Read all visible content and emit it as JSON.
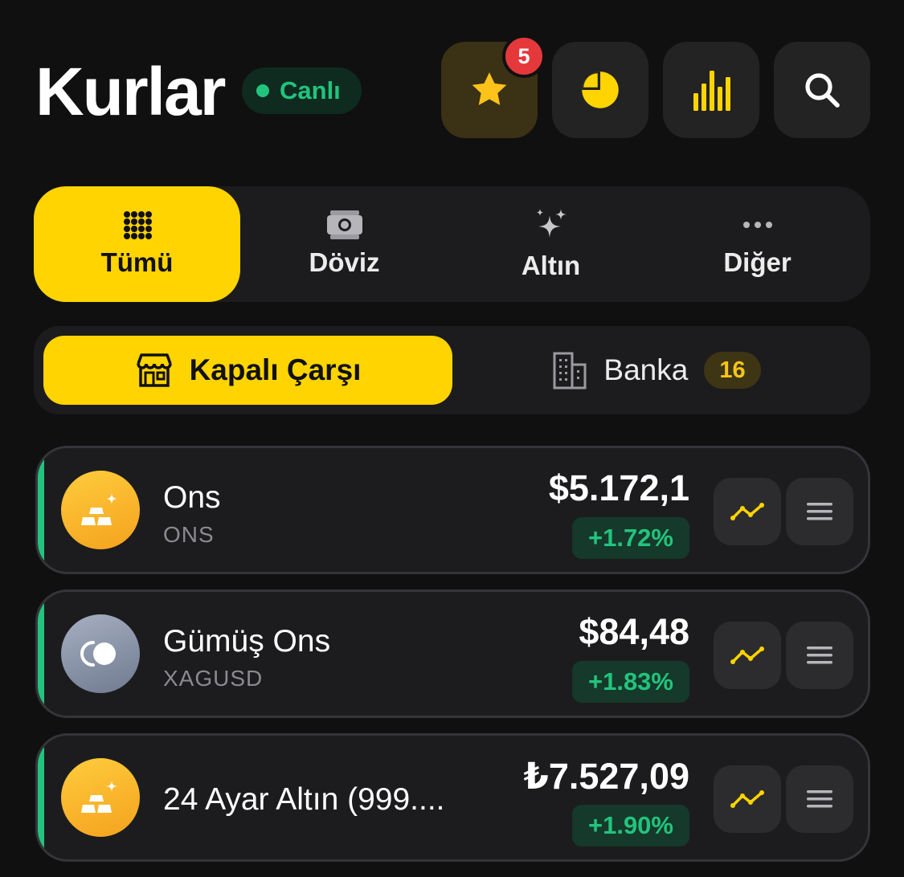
{
  "header": {
    "title": "Kurlar",
    "live_label": "Canlı",
    "favorites_count": "5",
    "icons": [
      "star-icon",
      "pie-chart-icon",
      "bar-chart-icon",
      "search-icon"
    ]
  },
  "categories": [
    {
      "label": "Tümü",
      "icon": "grid-icon",
      "active": true
    },
    {
      "label": "Döviz",
      "icon": "banknote-icon",
      "active": false
    },
    {
      "label": "Altın",
      "icon": "sparkles-icon",
      "active": false
    },
    {
      "label": "Diğer",
      "icon": "more-icon",
      "active": false
    }
  ],
  "markets": {
    "grand_bazaar": {
      "label": "Kapalı Çarşı",
      "icon": "store-icon",
      "active": true
    },
    "bank": {
      "label": "Banka",
      "icon": "building-icon",
      "count": "16",
      "active": false
    }
  },
  "rates": [
    {
      "name": "Ons",
      "code": "ONS",
      "price": "$5.172,1",
      "change": "+1.72%",
      "icon": "gold-bars-icon"
    },
    {
      "name": "Gümüş Ons",
      "code": "XAGUSD",
      "price": "$84,48",
      "change": "+1.83%",
      "icon": "silver-coin-icon"
    },
    {
      "name": "24 Ayar Altın (999....",
      "code": "",
      "price": "₺7.527,09",
      "change": "+1.90%",
      "icon": "gold-bars-icon"
    }
  ],
  "colors": {
    "accent_yellow": "#ffd400",
    "positive_green": "#22c47d",
    "background": "#101010",
    "surface": "#1c1c1e"
  }
}
